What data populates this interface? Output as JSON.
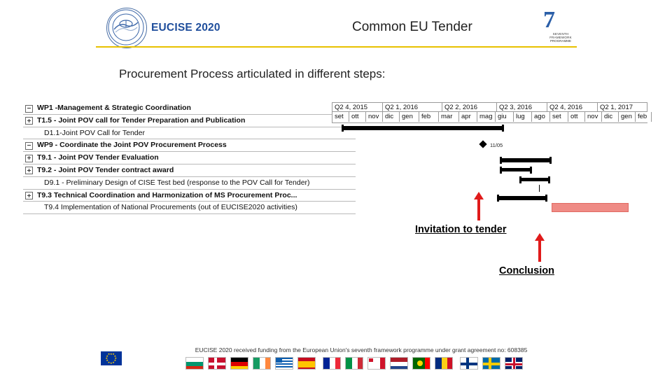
{
  "header": {
    "brand": "EUCISE 2020",
    "title": "Common EU Tender",
    "logo_left_name": "eucise-circular-logo",
    "logo_right_number": "7",
    "logo_right_caption": "SEVENTH FRAMEWORK",
    "logo_right_caption2": "PROGRAMME"
  },
  "subtitle": "Procurement Process articulated in different steps:",
  "gantt_left": {
    "rows": [
      {
        "text": "WP1 -Management & Strategic Coordination",
        "bold": true,
        "expander": "minus",
        "indent": false
      },
      {
        "text": "T1.5 - Joint POV call for Tender Preparation and Publication",
        "bold": true,
        "expander": "plus",
        "indent": false
      },
      {
        "text": "D1.1-Joint POV Call for Tender",
        "bold": false,
        "expander": "none",
        "indent": true
      },
      {
        "text": "WP9 - Coordinate the Joint POV Procurement Process",
        "bold": true,
        "expander": "minus",
        "indent": false
      },
      {
        "text": "T9.1 - Joint POV Tender Evaluation",
        "bold": true,
        "expander": "plus",
        "indent": false
      },
      {
        "text": "T9.2 - Joint POV Tender contract award",
        "bold": true,
        "expander": "plus",
        "indent": false
      },
      {
        "text": "D9.1 - Preliminary Design of CISE Test bed (response to the POV Call for Tender)",
        "bold": false,
        "expander": "none",
        "indent": true
      },
      {
        "text": "T9.3 Technical Coordination and Harmonization of MS Procurement Proc...",
        "bold": true,
        "expander": "plus",
        "indent": false
      },
      {
        "text": "T9.4 Implementation of National Procurements (out of EUCISE2020 activities)",
        "bold": false,
        "expander": "none",
        "indent": true
      }
    ]
  },
  "gantt_right": {
    "quarters": [
      "Q2 4, 2015",
      "Q2 1, 2016",
      "Q2 2, 2016",
      "Q2 3, 2016",
      "Q2 4, 2016",
      "Q2 1, 2017"
    ],
    "months": [
      "set",
      "ott",
      "nov",
      "dic",
      "gen",
      "feb",
      "mar",
      "apr",
      "mag",
      "giu",
      "lug",
      "ago",
      "set",
      "ott",
      "nov",
      "dic",
      "gen",
      "feb"
    ],
    "milestone_label": "11/05"
  },
  "callouts": {
    "invitation": "Invitation to tender",
    "conclusion": "Conclusion"
  },
  "footer": {
    "note": "EUCISE 2020 received funding from the European Union's seventh framework programme under grant agreement no: 608385",
    "eu_flag_name": "european-union-flag",
    "country_flags": [
      "bulgaria",
      "denmark",
      "germany",
      "ireland",
      "greece",
      "spain",
      "france",
      "italy",
      "malta",
      "netherlands",
      "portugal",
      "romania",
      "finland",
      "sweden",
      "united-kingdom"
    ]
  },
  "colors": {
    "brand_blue": "#1f4e9c",
    "rule_yellow": "#e8c100",
    "arrow_red": "#e01b1b",
    "red_bar": "#ef8b85"
  }
}
